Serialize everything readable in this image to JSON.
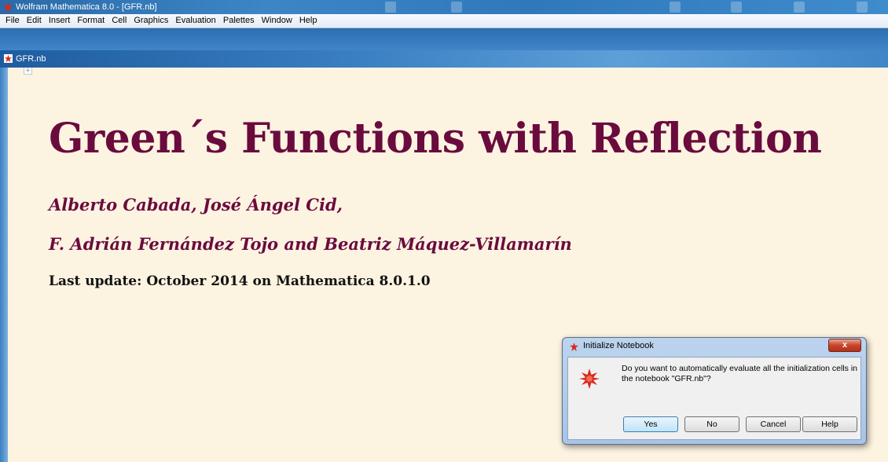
{
  "app": {
    "title": "Wolfram Mathematica 8.0 - [GFR.nb]",
    "accent_color": "#6a0b3e"
  },
  "menubar": {
    "items": [
      "File",
      "Edit",
      "Insert",
      "Format",
      "Cell",
      "Graphics",
      "Evaluation",
      "Palettes",
      "Window",
      "Help"
    ]
  },
  "notebook": {
    "tab_title": "GFR.nb",
    "title": "Green´s Functions with Reflection",
    "authors_line1": "Alberto Cabada, José Ángel Cid,",
    "authors_line2": "F. Adrián Fernández Tojo and Beatriz Máquez-Villamarín",
    "update_line": "Last update: October 2014  on Mathematica 8.0.1.0"
  },
  "dialog": {
    "title": "Initialize Notebook",
    "close_label": "x",
    "message": "Do you want to automatically evaluate all the initialization cells in the notebook \"GFR.nb\"?",
    "buttons": {
      "yes": "Yes",
      "no": "No",
      "cancel": "Cancel",
      "help": "Help"
    }
  }
}
